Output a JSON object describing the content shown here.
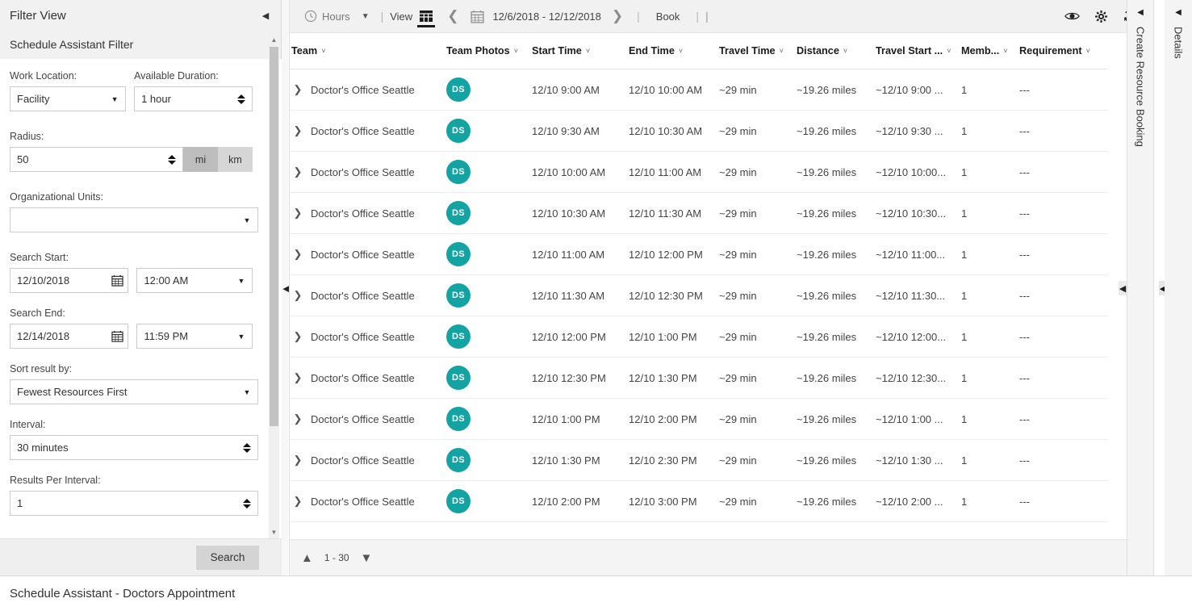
{
  "filter_panel": {
    "title": "Filter View",
    "collapse_icon": "triangle-left-icon",
    "subtitle": "Schedule Assistant Filter",
    "fields": {
      "work_location": {
        "label": "Work Location:",
        "value": "Facility"
      },
      "available_duration": {
        "label": "Available Duration:",
        "value": "1 hour"
      },
      "radius": {
        "label": "Radius:",
        "value": "50",
        "unit_mi": "mi",
        "unit_km": "km",
        "selected_unit": "mi"
      },
      "organizational_units": {
        "label": "Organizational Units:",
        "value": ""
      },
      "search_start": {
        "label": "Search Start:",
        "date": "12/10/2018",
        "time": "12:00 AM"
      },
      "search_end": {
        "label": "Search End:",
        "date": "12/14/2018",
        "time": "11:59 PM"
      },
      "sort_result_by": {
        "label": "Sort result by:",
        "value": "Fewest Resources First"
      },
      "interval": {
        "label": "Interval:",
        "value": "30 minutes"
      },
      "results_per_interval": {
        "label": "Results Per Interval:",
        "value": "1"
      }
    },
    "search_button": "Search"
  },
  "toolbar": {
    "clock_icon": "clock-icon",
    "hours_label": "Hours",
    "hours_caret": "chevron-down-icon",
    "separator": "|",
    "view_label": "View",
    "grid_icon": "grid-view-icon",
    "prev_icon": "chevron-left-icon",
    "calendar_icon": "calendar-icon",
    "date_range": "12/6/2018 - 12/12/2018",
    "next_icon": "chevron-right-icon",
    "separator2": "|",
    "book_label": "Book",
    "separator3": "|",
    "eye_icon": "eye-icon",
    "gear_icon": "gear-icon",
    "refresh_icon": "refresh-icon"
  },
  "grid": {
    "columns": [
      "Team",
      "Team Photos",
      "Start Time",
      "End Time",
      "Travel Time",
      "Distance",
      "Travel Start ...",
      "Memb...",
      "Requirement"
    ],
    "avatar_initials": "DS",
    "avatar_color": "#14a3a3",
    "expand_icon": "chevron-right-icon",
    "rows": [
      {
        "team": "Doctor's Office Seattle",
        "photo": "DS",
        "start": "12/10 9:00 AM",
        "end": "12/10 10:00 AM",
        "travel_time": "~29 min",
        "distance": "~19.26 miles",
        "travel_start": "~12/10 9:00 ...",
        "members": "1",
        "requirement": "---"
      },
      {
        "team": "Doctor's Office Seattle",
        "photo": "DS",
        "start": "12/10 9:30 AM",
        "end": "12/10 10:30 AM",
        "travel_time": "~29 min",
        "distance": "~19.26 miles",
        "travel_start": "~12/10 9:30 ...",
        "members": "1",
        "requirement": "---"
      },
      {
        "team": "Doctor's Office Seattle",
        "photo": "DS",
        "start": "12/10 10:00 AM",
        "end": "12/10 11:00 AM",
        "travel_time": "~29 min",
        "distance": "~19.26 miles",
        "travel_start": "~12/10 10:00...",
        "members": "1",
        "requirement": "---"
      },
      {
        "team": "Doctor's Office Seattle",
        "photo": "DS",
        "start": "12/10 10:30 AM",
        "end": "12/10 11:30 AM",
        "travel_time": "~29 min",
        "distance": "~19.26 miles",
        "travel_start": "~12/10 10:30...",
        "members": "1",
        "requirement": "---"
      },
      {
        "team": "Doctor's Office Seattle",
        "photo": "DS",
        "start": "12/10 11:00 AM",
        "end": "12/10 12:00 PM",
        "travel_time": "~29 min",
        "distance": "~19.26 miles",
        "travel_start": "~12/10 11:00...",
        "members": "1",
        "requirement": "---"
      },
      {
        "team": "Doctor's Office Seattle",
        "photo": "DS",
        "start": "12/10 11:30 AM",
        "end": "12/10 12:30 PM",
        "travel_time": "~29 min",
        "distance": "~19.26 miles",
        "travel_start": "~12/10 11:30...",
        "members": "1",
        "requirement": "---"
      },
      {
        "team": "Doctor's Office Seattle",
        "photo": "DS",
        "start": "12/10 12:00 PM",
        "end": "12/10 1:00 PM",
        "travel_time": "~29 min",
        "distance": "~19.26 miles",
        "travel_start": "~12/10 12:00...",
        "members": "1",
        "requirement": "---"
      },
      {
        "team": "Doctor's Office Seattle",
        "photo": "DS",
        "start": "12/10 12:30 PM",
        "end": "12/10 1:30 PM",
        "travel_time": "~29 min",
        "distance": "~19.26 miles",
        "travel_start": "~12/10 12:30...",
        "members": "1",
        "requirement": "---"
      },
      {
        "team": "Doctor's Office Seattle",
        "photo": "DS",
        "start": "12/10 1:00 PM",
        "end": "12/10 2:00 PM",
        "travel_time": "~29 min",
        "distance": "~19.26 miles",
        "travel_start": "~12/10 1:00 ...",
        "members": "1",
        "requirement": "---"
      },
      {
        "team": "Doctor's Office Seattle",
        "photo": "DS",
        "start": "12/10 1:30 PM",
        "end": "12/10 2:30 PM",
        "travel_time": "~29 min",
        "distance": "~19.26 miles",
        "travel_start": "~12/10 1:30 ...",
        "members": "1",
        "requirement": "---"
      },
      {
        "team": "Doctor's Office Seattle",
        "photo": "DS",
        "start": "12/10 2:00 PM",
        "end": "12/10 3:00 PM",
        "travel_time": "~29 min",
        "distance": "~19.26 miles",
        "travel_start": "~12/10 2:00 ...",
        "members": "1",
        "requirement": "---"
      }
    ]
  },
  "pager": {
    "up_icon": "chevron-up-icon",
    "range_label": "1 - 30",
    "down_icon": "chevron-down-icon"
  },
  "side_tabs": {
    "create_resource_booking": {
      "label": "Create Resource Booking",
      "collapse_icon": "triangle-left-icon"
    },
    "details": {
      "label": "Details",
      "collapse_icon": "triangle-left-icon"
    }
  },
  "statusbar": {
    "text": "Schedule Assistant - Doctors Appointment"
  }
}
